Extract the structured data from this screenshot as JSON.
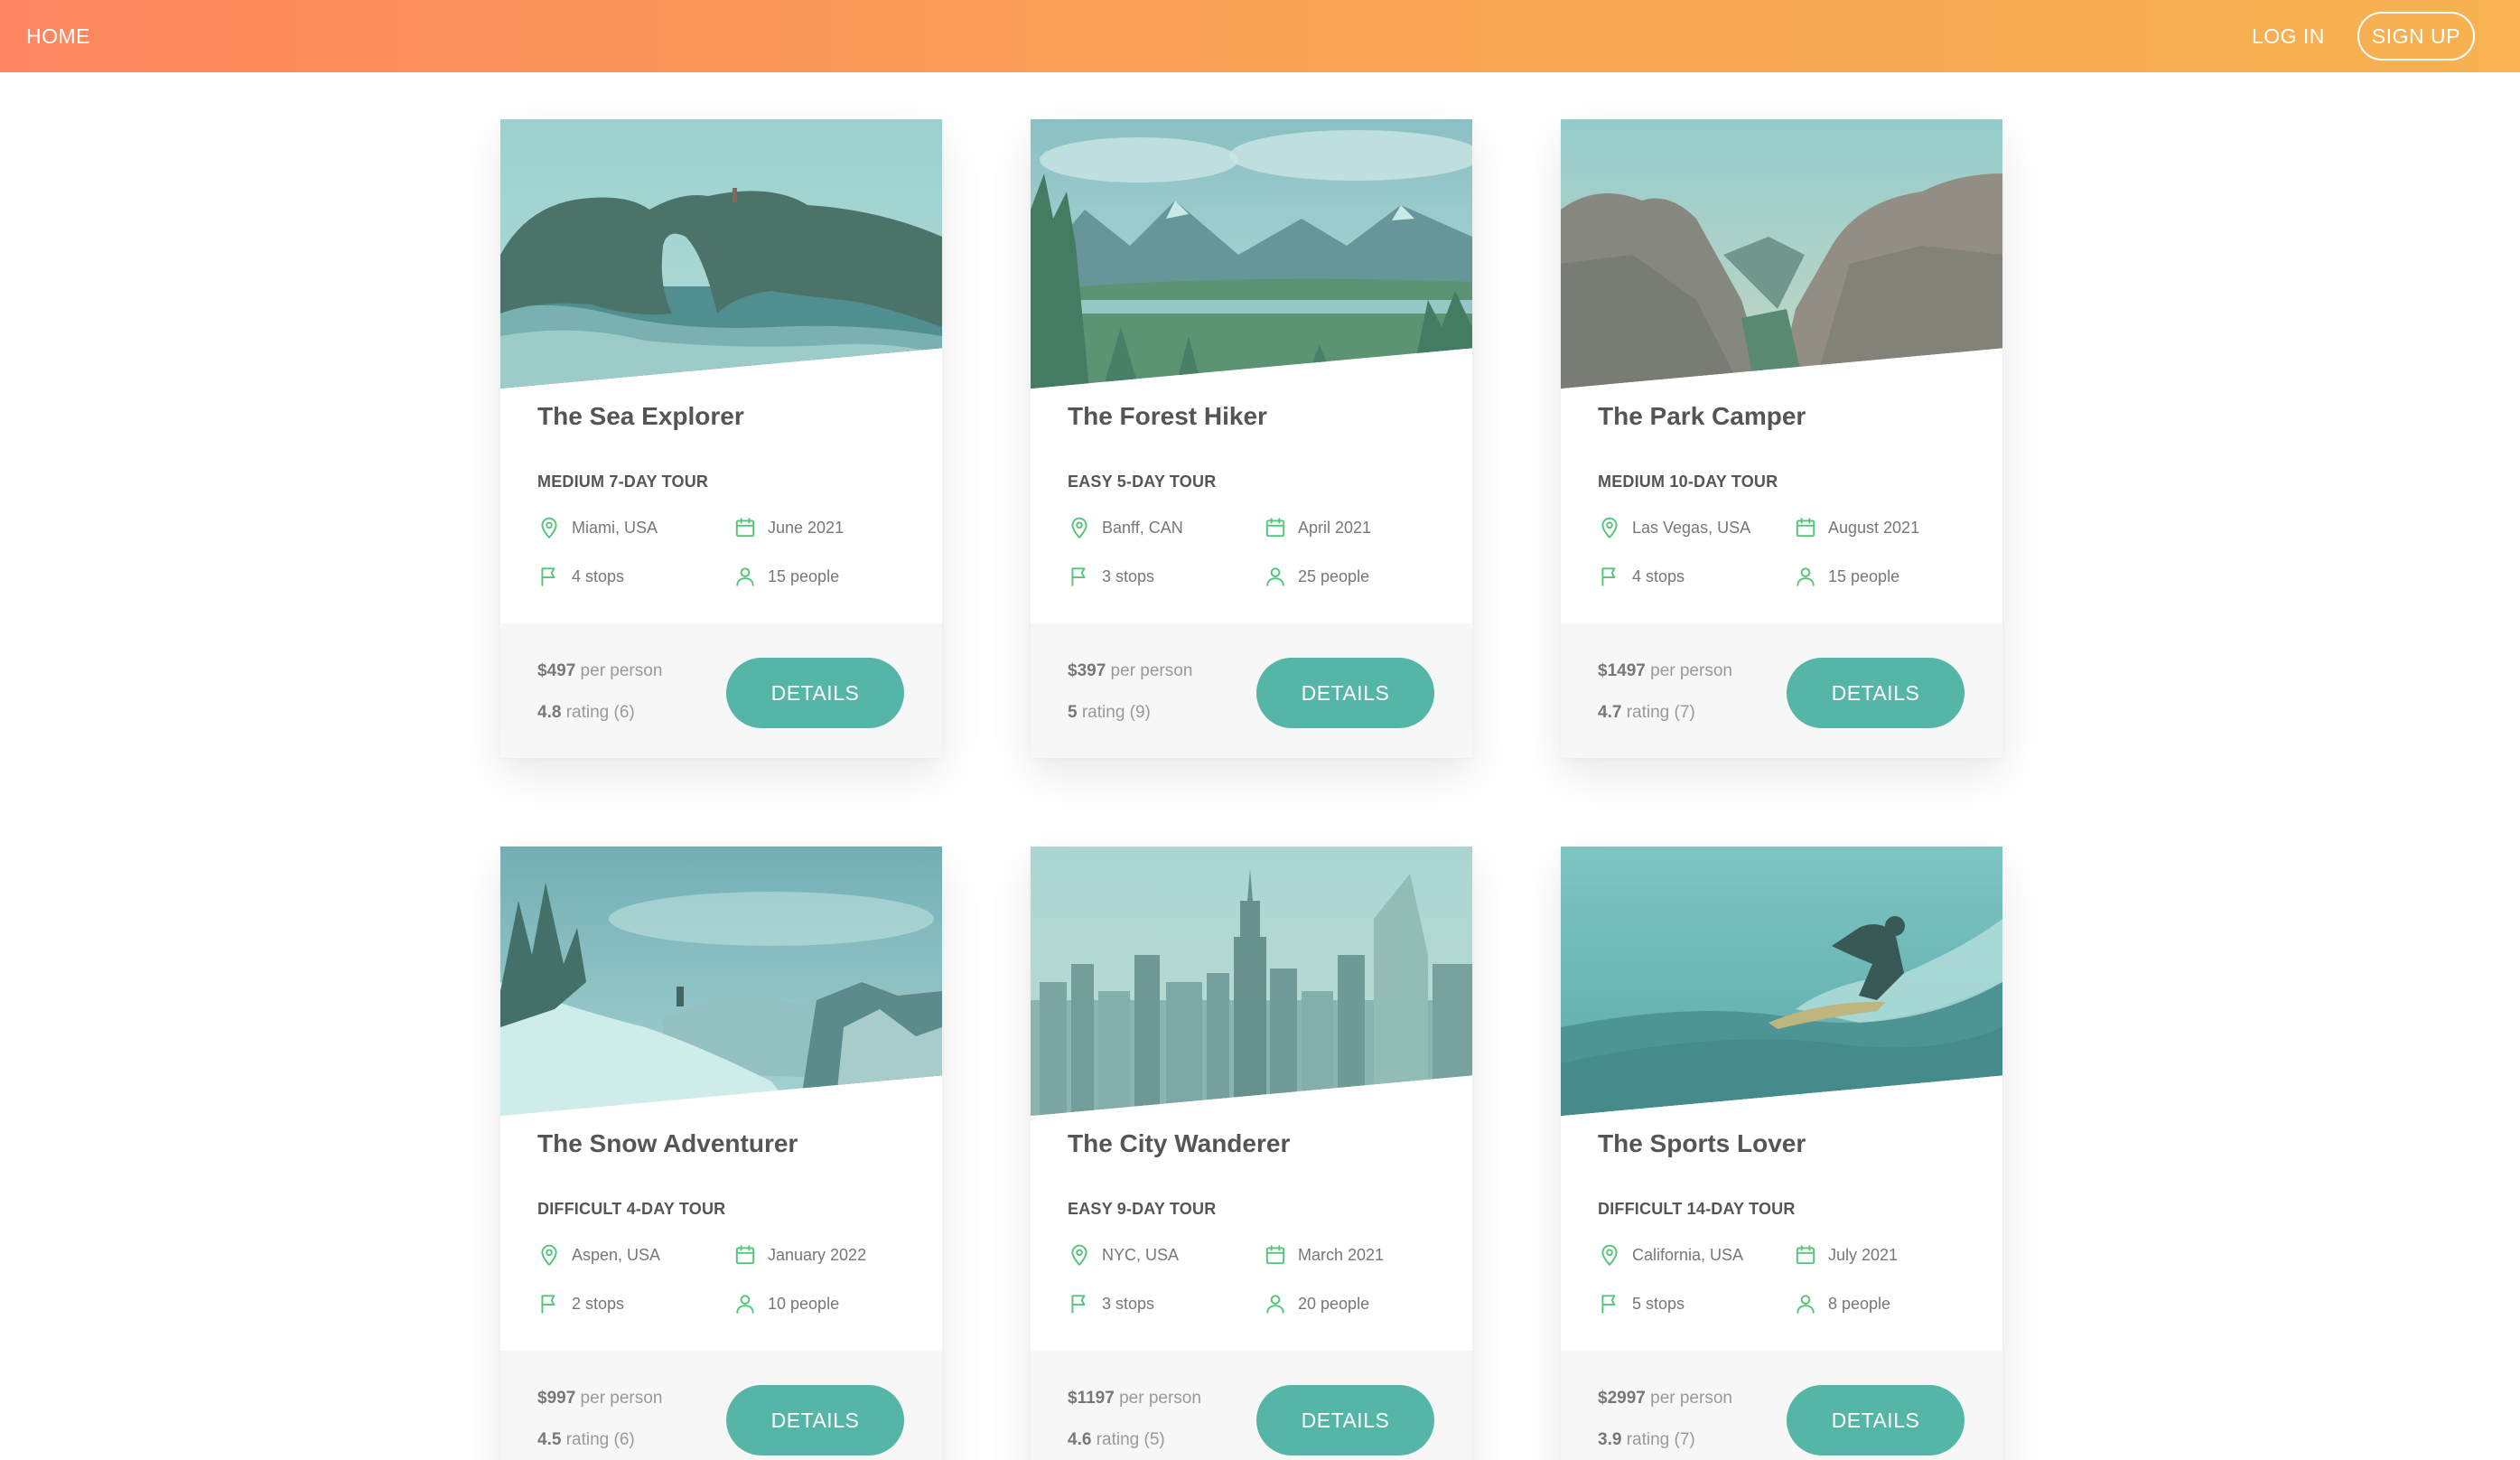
{
  "nav": {
    "home": "HOME",
    "login": "LOG IN",
    "signup": "SIGN UP"
  },
  "colors": {
    "accent": "#55b6a8",
    "icon": "#55c57a",
    "navStart": "#fd8660",
    "navEnd": "#f7b251"
  },
  "tours": [
    {
      "title": "The Sea Explorer",
      "subtitle": "MEDIUM 7-DAY TOUR",
      "location": "Miami, USA",
      "date": "June 2021",
      "stops": "4 stops",
      "people": "15 people",
      "price": "$497",
      "price_suffix": " per person",
      "rating": "4.8",
      "rating_suffix": " rating (6)",
      "button": "DETAILS",
      "image": "sea-arch"
    },
    {
      "title": "The Forest Hiker",
      "subtitle": "EASY 5-DAY TOUR",
      "location": "Banff, CAN",
      "date": "April 2021",
      "stops": "3 stops",
      "people": "25 people",
      "price": "$397",
      "price_suffix": " per person",
      "rating": "5",
      "rating_suffix": " rating (9)",
      "button": "DETAILS",
      "image": "mountain-forest"
    },
    {
      "title": "The Park Camper",
      "subtitle": "MEDIUM 10-DAY TOUR",
      "location": "Las Vegas, USA",
      "date": "August 2021",
      "stops": "4 stops",
      "people": "15 people",
      "price": "$1497",
      "price_suffix": " per person",
      "rating": "4.7",
      "rating_suffix": " rating (7)",
      "button": "DETAILS",
      "image": "canyon"
    },
    {
      "title": "The Snow Adventurer",
      "subtitle": "DIFFICULT 4-DAY TOUR",
      "location": "Aspen, USA",
      "date": "January 2022",
      "stops": "2 stops",
      "people": "10 people",
      "price": "$997",
      "price_suffix": " per person",
      "rating": "4.5",
      "rating_suffix": " rating (6)",
      "button": "DETAILS",
      "image": "snow-mountain"
    },
    {
      "title": "The City Wanderer",
      "subtitle": "EASY 9-DAY TOUR",
      "location": "NYC, USA",
      "date": "March 2021",
      "stops": "3 stops",
      "people": "20 people",
      "price": "$1197",
      "price_suffix": " per person",
      "rating": "4.6",
      "rating_suffix": " rating (5)",
      "button": "DETAILS",
      "image": "city-skyline"
    },
    {
      "title": "The Sports Lover",
      "subtitle": "DIFFICULT 14-DAY TOUR",
      "location": "California, USA",
      "date": "July 2021",
      "stops": "5 stops",
      "people": "8 people",
      "price": "$2997",
      "price_suffix": " per person",
      "rating": "3.9",
      "rating_suffix": " rating (7)",
      "button": "DETAILS",
      "image": "surfer-wave"
    }
  ]
}
